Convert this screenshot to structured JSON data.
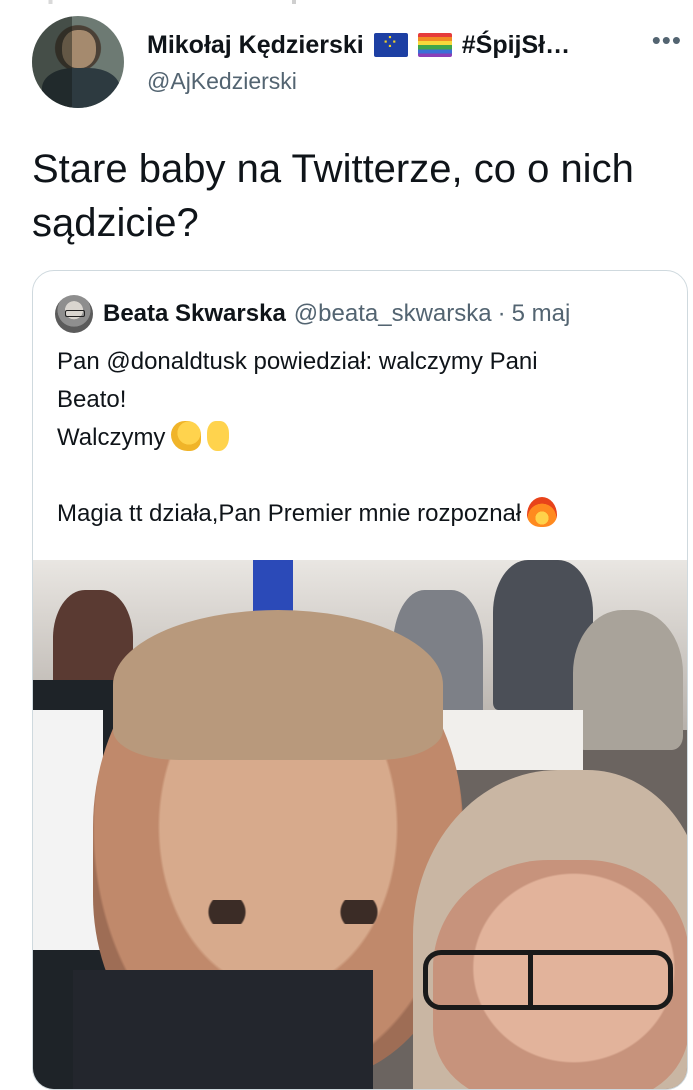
{
  "author": {
    "display_name": "Mikołaj Kędzierski",
    "name_tag": "#ŚpijSł…",
    "handle": "@AjKedzierski",
    "badges": [
      "eu-flag-icon",
      "rainbow-flag-icon"
    ]
  },
  "more_label": "•••",
  "tweet": {
    "text": "Stare baby na Twitterze, co o nich sądzicie?"
  },
  "quoted": {
    "name": "Beata Skwarska",
    "handle": "@beata_skwarska",
    "separator": "·",
    "time": "5 maj",
    "lines": [
      "Pan @donaldtusk powiedział: walczymy Pani",
      "Beato!",
      "Walczymy",
      "",
      "Magia tt działa,Pan Premier mnie rozpoznał"
    ],
    "emoji": [
      "muscle-emoji-icon",
      "victory-emoji-icon",
      "fire-emoji-icon"
    ]
  },
  "colors": {
    "text": "#0f1419",
    "secondary": "#536471",
    "border": "#cfd9de"
  }
}
